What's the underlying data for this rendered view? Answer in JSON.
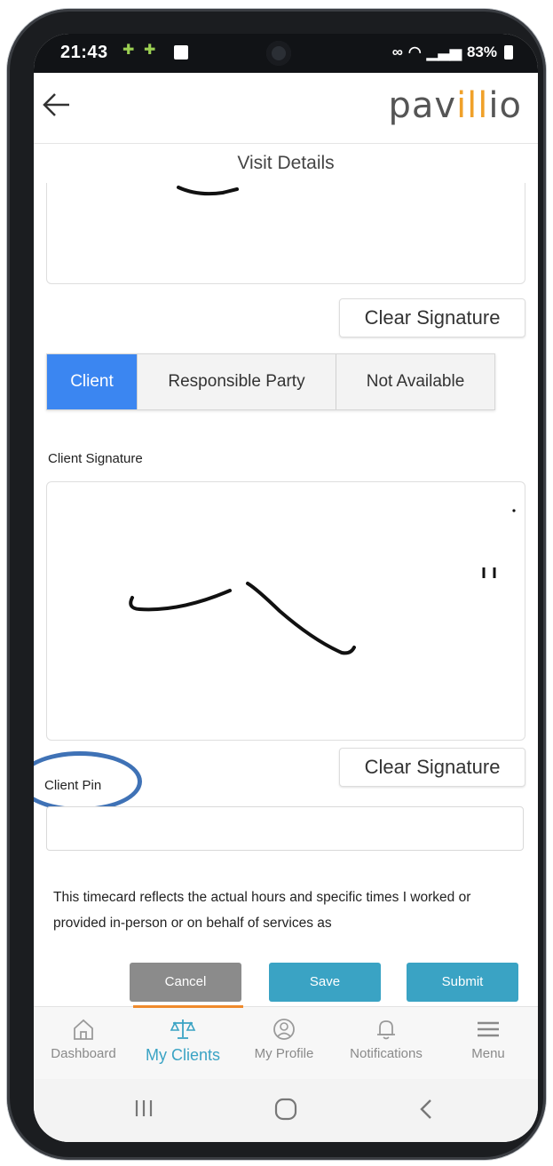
{
  "status_bar": {
    "time": "21:43",
    "battery": "83%"
  },
  "app": {
    "logo_text_start": "pav",
    "logo_text_accent": "ill",
    "logo_text_end": "io",
    "page_title": "Visit Details"
  },
  "first_signature": {
    "clear_label": "Clear Signature"
  },
  "signer_options": {
    "items": [
      {
        "label": "Client",
        "selected": true
      },
      {
        "label": "Responsible Party",
        "selected": false
      },
      {
        "label": "Not Available",
        "selected": false
      }
    ]
  },
  "client_signature": {
    "label": "Client Signature",
    "clear_label": "Clear Signature"
  },
  "client_pin": {
    "label": "Client Pin",
    "value": ""
  },
  "disclaimer": {
    "text": "This timecard reflects the actual hours and specific times I worked or provided in-person or on behalf of services as"
  },
  "actions": {
    "cancel": "Cancel",
    "save": "Save",
    "submit": "Submit"
  },
  "bottom_nav": {
    "items": [
      {
        "label": "Dashboard",
        "icon": "home-icon",
        "active": false
      },
      {
        "label": "My Clients",
        "icon": "clients-icon",
        "active": true
      },
      {
        "label": "My Profile",
        "icon": "profile-icon",
        "active": false
      },
      {
        "label": "Notifications",
        "icon": "bell-icon",
        "active": false
      },
      {
        "label": "Menu",
        "icon": "hamburger-icon",
        "active": false
      }
    ]
  },
  "colors": {
    "primary_blue": "#3b86f1",
    "accent_teal": "#3aa3c4",
    "brand_orange": "#f0a12a",
    "annotation_circle": "#3f72b6"
  }
}
